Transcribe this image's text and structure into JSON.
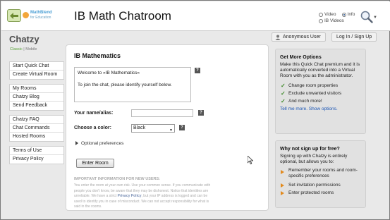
{
  "header": {
    "title": "IB Math Chatroom",
    "logo_line1": "MathBlend",
    "logo_line2": "for Education",
    "radio": {
      "video": "Video",
      "info": "Info",
      "ib_videos": "IB Videos",
      "selected": "Info"
    }
  },
  "brand": {
    "name": "Chatzy",
    "classic": "Classic",
    "sep": " | ",
    "mobile": "Mobile"
  },
  "account": {
    "user_label": "Anonymous User",
    "login_label": "Log In / Sign Up"
  },
  "sidebar": {
    "groups": [
      {
        "items": [
          {
            "label": "Start Quick Chat"
          },
          {
            "label": "Create Virtual Room"
          }
        ]
      },
      {
        "items": [
          {
            "label": "My Rooms"
          },
          {
            "label": "Chatzy Blog"
          },
          {
            "label": "Send Feedback"
          }
        ]
      },
      {
        "items": [
          {
            "label": "Chatzy FAQ"
          },
          {
            "label": "Chat Commands"
          },
          {
            "label": "Hosted Rooms"
          }
        ]
      },
      {
        "items": [
          {
            "label": "Terms of Use"
          },
          {
            "label": "Privacy Policy"
          }
        ]
      }
    ]
  },
  "main": {
    "room_title": "IB Mathematics",
    "welcome_line1": "Welcome to »IB Mathematics«",
    "welcome_line2": "To join the chat, please identify yourself below.",
    "name_label": "Your name/alias:",
    "name_value": "",
    "color_label": "Choose a color:",
    "color_value": "Black",
    "optional_label": "Optional preferences",
    "enter_button": "Enter Room",
    "info_title": "IMPORTANT INFORMATION FOR NEW USERS:",
    "info_text_1": "You enter the room at your own risk. Use your common sense. If you communicate with people you don't know, be aware that they may be dishonest. Notice that identities are unreliable. We have a strict ",
    "info_link": "Privacy Policy",
    "info_text_2": ", but your IP address is logged and can be used to identify you in case of misconduct. We can not accept responsibility for what is said in the rooms.",
    "help_glyph": "?"
  },
  "premium": {
    "title": "Get More Options",
    "text": "Make this Quick Chat premium and it is automatically converted into a Virtual Room with you as the administrator.",
    "items": [
      {
        "label": "Change room properties"
      },
      {
        "label": "Exclude unwanted visitors"
      },
      {
        "label": "And much more!"
      }
    ],
    "link": "Tell me more. Show options."
  },
  "signup": {
    "title": "Why not sign up for free?",
    "text": "Signing up with Chatzy is entirely optional, but allows you to:",
    "items": [
      {
        "label": "Remember your rooms and room-specific preferences"
      },
      {
        "label": "Set invitation permissions"
      },
      {
        "label": "Enter protected rooms"
      }
    ]
  },
  "colors": {
    "accent": "#4a9fd5",
    "check": "#3f8a2a",
    "arrow": "#e28a1e",
    "link": "#1a55b5"
  }
}
